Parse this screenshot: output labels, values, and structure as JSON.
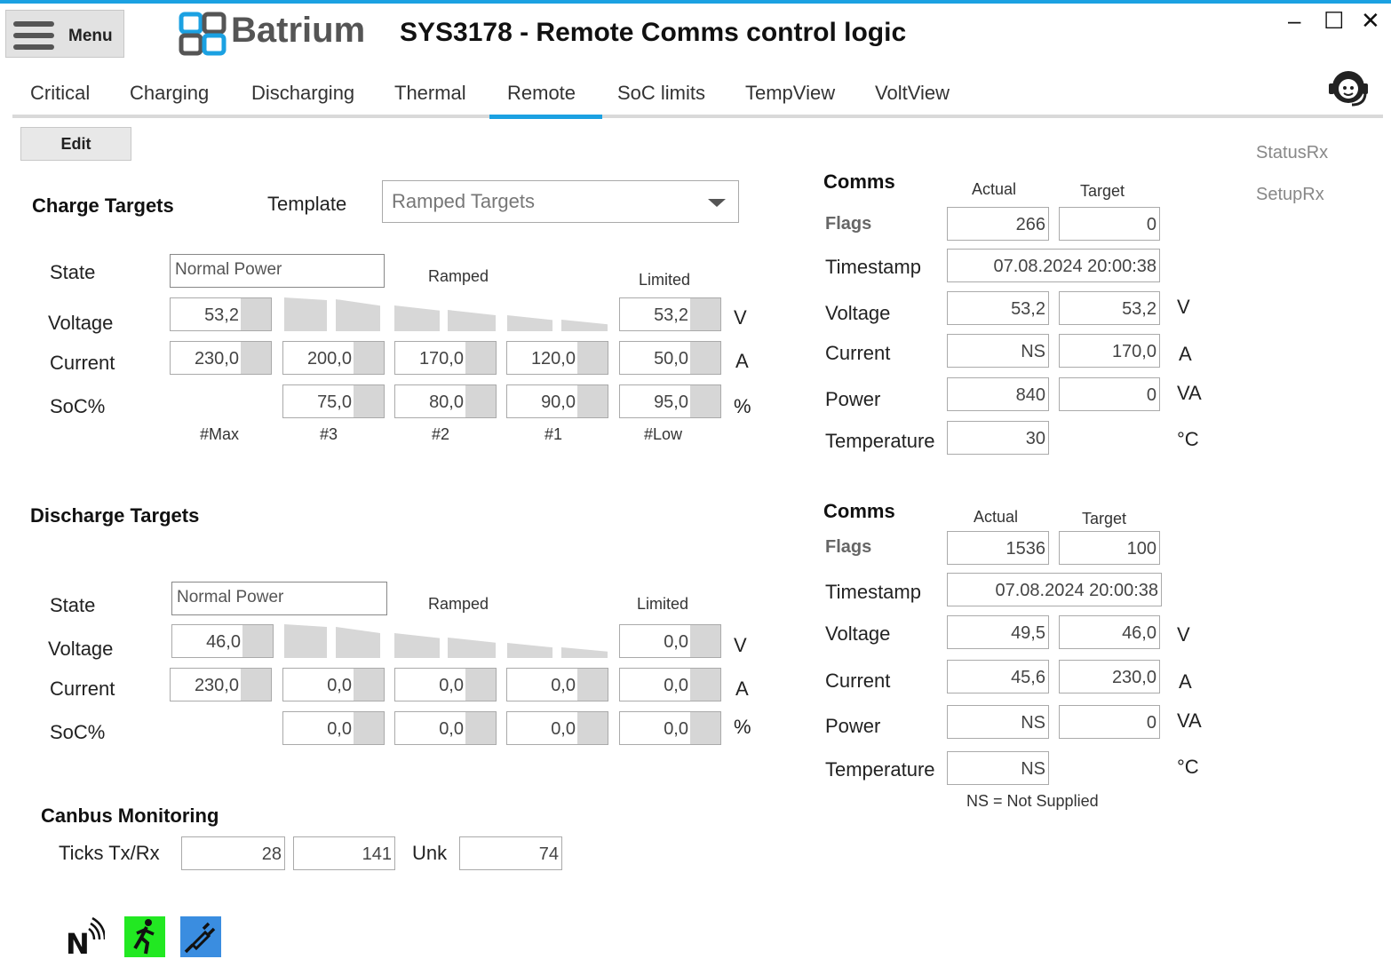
{
  "header": {
    "menu_label": "Menu",
    "brand": "Batrium",
    "title": "SYS3178 - Remote Comms control logic",
    "minimize": "–",
    "maximize": "☐",
    "close": "✕"
  },
  "tabs": [
    "Critical",
    "Charging",
    "Discharging",
    "Thermal",
    "Remote",
    "SoC limits",
    "TempView",
    "VoltView"
  ],
  "active_tab": "Remote",
  "edit_label": "Edit",
  "side_links": [
    "StatusRx",
    "SetupRx"
  ],
  "charge": {
    "heading": "Charge Targets",
    "template_label": "Template",
    "template_value": "Ramped Targets",
    "state_label": "State",
    "state_value": "Normal Power",
    "ramped_label": "Ramped",
    "limited_label": "Limited",
    "row_labels": [
      "Voltage",
      "Current",
      "SoC%"
    ],
    "units": [
      "V",
      "A",
      "%"
    ],
    "voltage_max": "53,2",
    "voltage_low": "53,2",
    "current": [
      "230,0",
      "200,0",
      "170,0",
      "120,0",
      "50,0"
    ],
    "soc": [
      "75,0",
      "80,0",
      "90,0",
      "95,0"
    ],
    "column_labels": [
      "#Max",
      "#3",
      "#2",
      "#1",
      "#Low"
    ]
  },
  "discharge": {
    "heading": "Discharge Targets",
    "state_label": "State",
    "state_value": "Normal Power",
    "ramped_label": "Ramped",
    "limited_label": "Limited",
    "row_labels": [
      "Voltage",
      "Current",
      "SoC%"
    ],
    "units": [
      "V",
      "A",
      "%"
    ],
    "voltage_max": "46,0",
    "voltage_low": "0,0",
    "current": [
      "230,0",
      "0,0",
      "0,0",
      "0,0",
      "0,0"
    ],
    "soc": [
      "0,0",
      "0,0",
      "0,0",
      "0,0"
    ]
  },
  "comms_charge": {
    "heading": "Comms",
    "actual_label": "Actual",
    "target_label": "Target",
    "flags_label": "Flags",
    "flags_actual": "266",
    "flags_target": "0",
    "timestamp_label": "Timestamp",
    "timestamp": "07.08.2024 20:00:38",
    "voltage_label": "Voltage",
    "voltage_actual": "53,2",
    "voltage_target": "53,2",
    "voltage_unit": "V",
    "current_label": "Current",
    "current_actual": "NS",
    "current_target": "170,0",
    "current_unit": "A",
    "power_label": "Power",
    "power_actual": "840",
    "power_target": "0",
    "power_unit": "VA",
    "temp_label": "Temperature",
    "temp_actual": "30",
    "temp_unit": "°C"
  },
  "comms_discharge": {
    "heading": "Comms",
    "actual_label": "Actual",
    "target_label": "Target",
    "flags_label": "Flags",
    "flags_actual": "1536",
    "flags_target": "100",
    "timestamp_label": "Timestamp",
    "timestamp": "07.08.2024 20:00:38",
    "voltage_label": "Voltage",
    "voltage_actual": "49,5",
    "voltage_target": "46,0",
    "voltage_unit": "V",
    "current_label": "Current",
    "current_actual": "45,6",
    "current_target": "230,0",
    "current_unit": "A",
    "power_label": "Power",
    "power_actual": "NS",
    "power_target": "0",
    "power_unit": "VA",
    "temp_label": "Temperature",
    "temp_actual": "NS",
    "temp_unit": "°C",
    "ns_note": "NS = Not Supplied"
  },
  "canbus": {
    "heading": "Canbus Monitoring",
    "ticks_label": "Ticks Tx/Rx",
    "tx": "28",
    "rx": "141",
    "unk_label": "Unk",
    "unk": "74"
  },
  "status_icons": [
    "network-signal-icon",
    "running-man-icon",
    "plug-icon"
  ],
  "colors": {
    "accent": "#1ba1e2",
    "running_bg": "#22e822",
    "plug_bg": "#3a8de0"
  }
}
